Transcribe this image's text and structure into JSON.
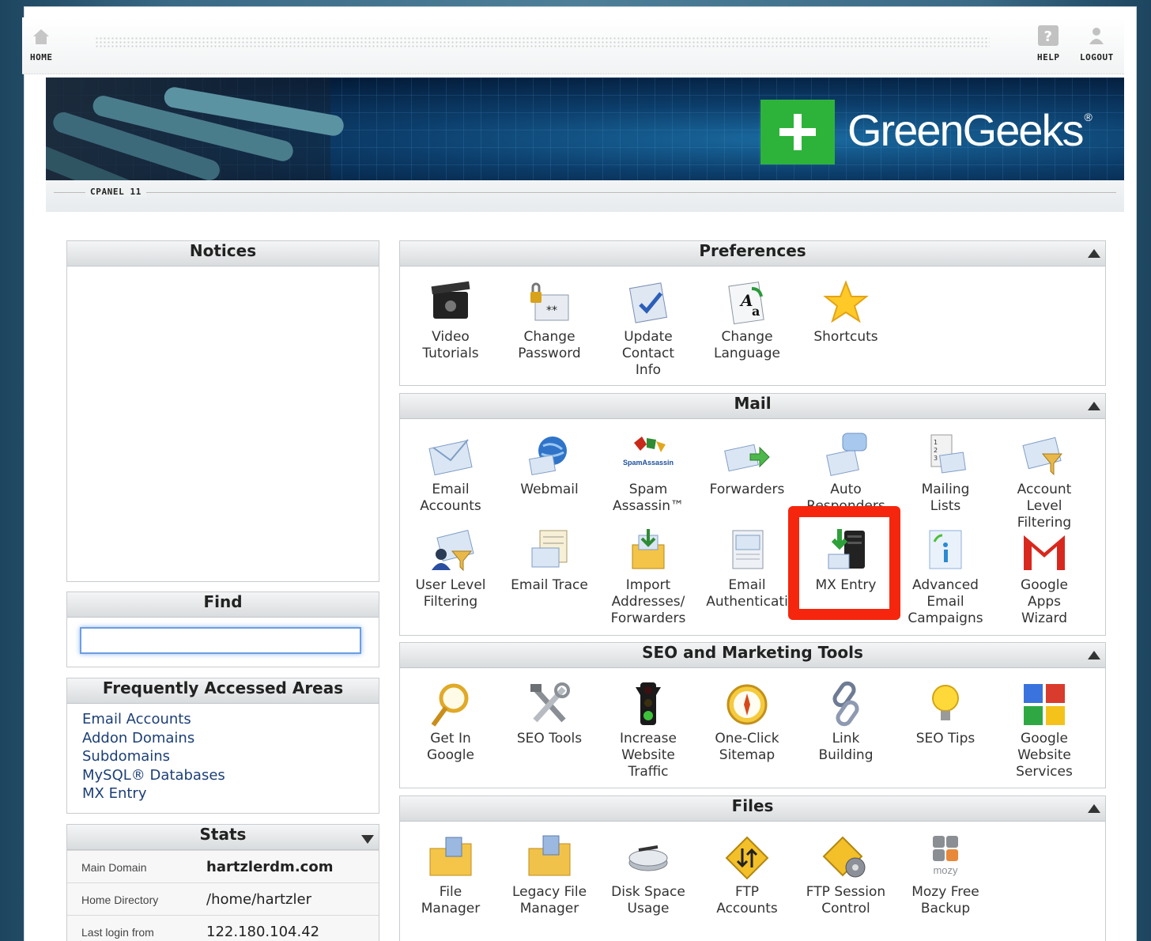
{
  "topnav": {
    "home": "HOME",
    "help": "HELP",
    "logout": "LOGOUT"
  },
  "banner": {
    "brand": "GreenGeeks",
    "reg": "®"
  },
  "cpanel_label": "CPANEL 11",
  "notices": {
    "title": "Notices"
  },
  "find": {
    "title": "Find",
    "value": ""
  },
  "frequent": {
    "title": "Frequently Accessed Areas",
    "links": [
      "Email Accounts",
      "Addon Domains",
      "Subdomains",
      "MySQL® Databases",
      "MX Entry"
    ]
  },
  "stats": {
    "title": "Stats",
    "rows": [
      {
        "key": "Main Domain",
        "value": "hartzlerdm.com"
      },
      {
        "key": "Home Directory",
        "value": "/home/hartzler"
      },
      {
        "key": "Last login from",
        "value": "122.180.104.42"
      }
    ]
  },
  "preferences": {
    "title": "Preferences",
    "items": [
      {
        "label": "Video\nTutorials",
        "icon": "video-icon"
      },
      {
        "label": "Change\nPassword",
        "icon": "password-icon"
      },
      {
        "label": "Update\nContact\nInfo",
        "icon": "contact-icon"
      },
      {
        "label": "Change\nLanguage",
        "icon": "language-icon"
      },
      {
        "label": "Shortcuts",
        "icon": "star-icon"
      }
    ]
  },
  "mail": {
    "title": "Mail",
    "items": [
      {
        "label": "Email\nAccounts",
        "icon": "envelope-icon"
      },
      {
        "label": "Webmail",
        "icon": "webmail-icon"
      },
      {
        "label": "Spam\nAssassin™",
        "icon": "spamassassin-icon"
      },
      {
        "label": "Forwarders",
        "icon": "forwarders-icon"
      },
      {
        "label": "Auto\nResponders",
        "icon": "autoresponder-icon"
      },
      {
        "label": "Mailing\nLists",
        "icon": "mailing-list-icon"
      },
      {
        "label": "Account\nLevel\nFiltering",
        "icon": "account-filter-icon"
      },
      {
        "label": "User Level\nFiltering",
        "icon": "user-filter-icon"
      },
      {
        "label": "Email Trace",
        "icon": "email-trace-icon"
      },
      {
        "label": "Import\nAddresses/\nForwarders",
        "icon": "import-icon"
      },
      {
        "label": "Email\nAuthenticati",
        "icon": "email-auth-icon"
      },
      {
        "label": "MX Entry",
        "icon": "mx-entry-icon"
      },
      {
        "label": "Advanced\nEmail\nCampaigns",
        "icon": "campaigns-icon"
      },
      {
        "label": "Google\nApps\nWizard",
        "icon": "gmail-icon"
      }
    ]
  },
  "seo": {
    "title": "SEO and Marketing Tools",
    "items": [
      {
        "label": "Get In\nGoogle",
        "icon": "magnifier-icon"
      },
      {
        "label": "SEO Tools",
        "icon": "tools-icon"
      },
      {
        "label": "Increase\nWebsite\nTraffic",
        "icon": "traffic-light-icon"
      },
      {
        "label": "One-Click\nSitemap",
        "icon": "compass-icon"
      },
      {
        "label": "Link\nBuilding",
        "icon": "chain-icon"
      },
      {
        "label": "SEO Tips",
        "icon": "lightbulb-icon"
      },
      {
        "label": "Google\nWebsite\nServices",
        "icon": "google-icon"
      }
    ]
  },
  "files": {
    "title": "Files",
    "items": [
      {
        "label": "File\nManager",
        "icon": "folder-icon"
      },
      {
        "label": "Legacy File\nManager",
        "icon": "legacy-folder-icon"
      },
      {
        "label": "Disk Space\nUsage",
        "icon": "disk-icon"
      },
      {
        "label": "FTP\nAccounts",
        "icon": "ftp-icon"
      },
      {
        "label": "FTP Session\nControl",
        "icon": "ftp-session-icon"
      },
      {
        "label": "Mozy Free\nBackup",
        "icon": "mozy-icon"
      }
    ],
    "mozy_text": "mozy"
  },
  "colors": {
    "highlight": "#f5260d",
    "brand_green": "#2eb33a",
    "link": "#1c3f76"
  }
}
